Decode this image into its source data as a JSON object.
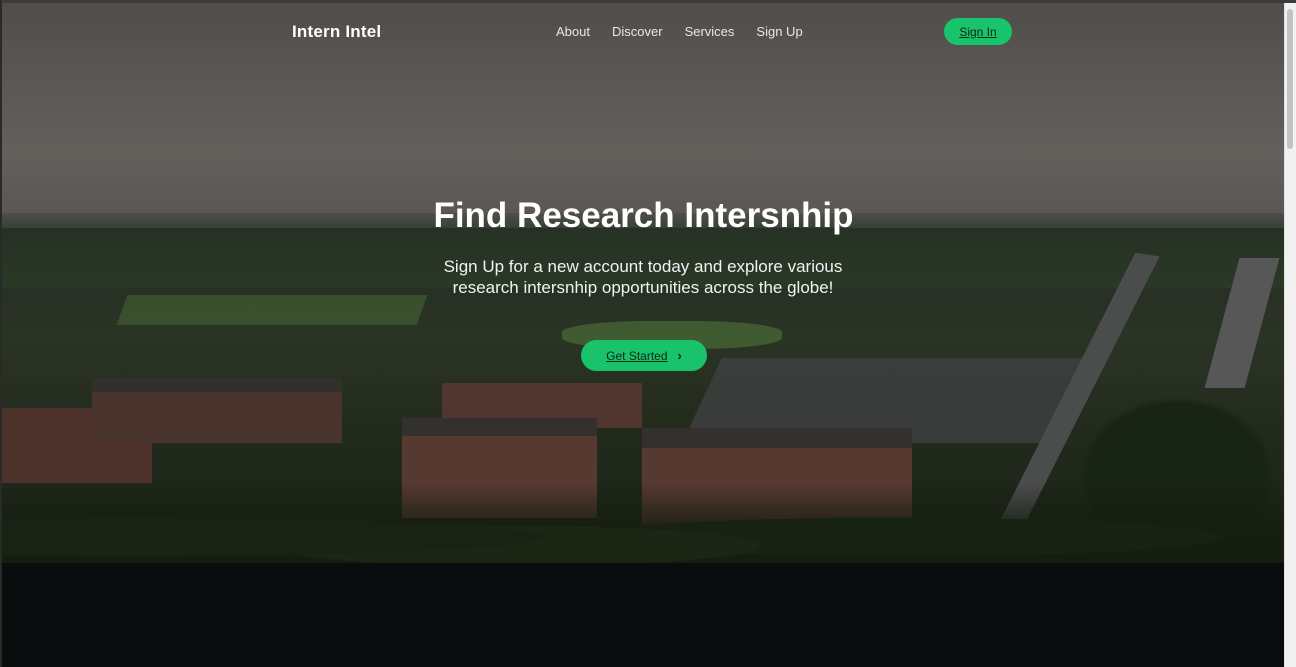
{
  "brand": "Intern Intel",
  "nav": {
    "links": [
      "About",
      "Discover",
      "Services",
      "Sign Up"
    ],
    "signin_label": "Sign In"
  },
  "hero": {
    "title": "Find Research Intersnhip",
    "subtitle": "Sign Up for a new account today and explore various research intersnhip opportunities across the globe!",
    "cta_label": "Get Started",
    "background": "aerial campus photo"
  },
  "colors": {
    "accent": "#18c36b",
    "footer_bg": "#0a0d0d"
  }
}
